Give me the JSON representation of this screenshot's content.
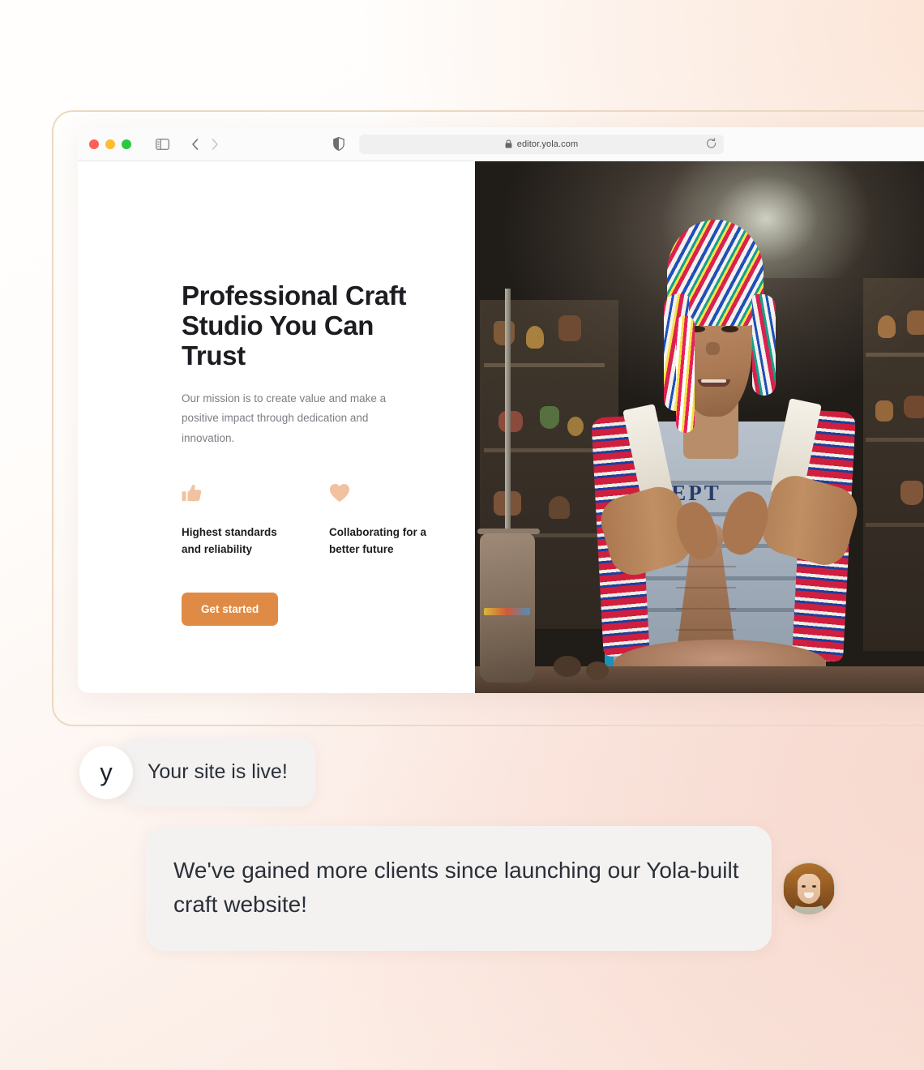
{
  "browser": {
    "traffic_lights": [
      "close",
      "minimize",
      "maximize"
    ],
    "url": "editor.yola.com",
    "icons": {
      "sidebar": "sidebar-toggle-icon",
      "back": "chevron-left-icon",
      "forward": "chevron-right-icon",
      "shield": "privacy-shield-icon",
      "lock": "lock-icon",
      "reload": "reload-icon"
    }
  },
  "hero": {
    "headline": "Professional Craft Studio You Can Trust",
    "subtext": "Our mission is to create value and make a positive impact through dedication and innovation.",
    "features": [
      {
        "icon": "thumbs-up-icon",
        "label": "Highest standards and reliability"
      },
      {
        "icon": "heart-icon",
        "label": "Collaborating for a better future"
      }
    ],
    "cta_label": "Get started",
    "photo_alt": "Artisan potter wearing a colorful Andean chullo hat shaping clay on a pottery wheel"
  },
  "chat": {
    "brand_initial": "y",
    "message_1": "Your site is live!",
    "message_2": "We've gained more clients since launching our Yola-built craft website!",
    "user_avatar_alt": "Smiling woman with long wavy auburn hair"
  },
  "colors": {
    "cta_orange": "#e08b45",
    "feature_icon_peach": "#f0c2a0",
    "bubble_grey": "#f4f2f1",
    "frame_tan": "#ecd9c3",
    "heading_dark": "#1c1c21",
    "body_grey": "#7d7d84",
    "bg_peach": "#f7d9cf"
  }
}
